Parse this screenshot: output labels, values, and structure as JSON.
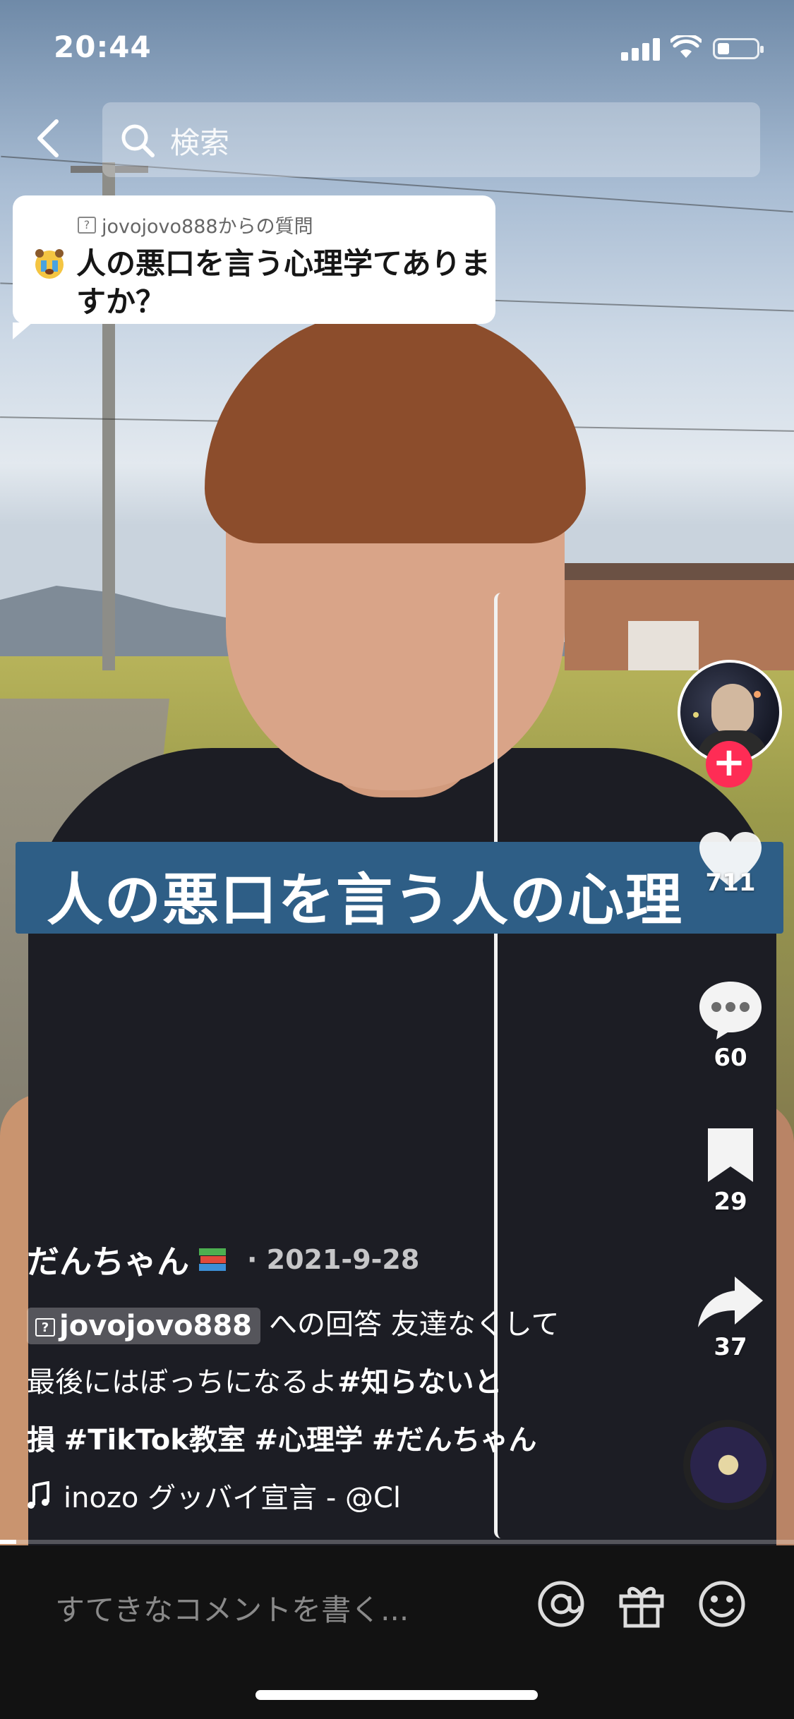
{
  "status": {
    "time": "20:44"
  },
  "search": {
    "placeholder": "検索"
  },
  "question": {
    "from": "jovojovo888からの質問",
    "text": "人の悪口を言う心理学てありますか？"
  },
  "caption": "人の悪口を言う人の心理",
  "actions": {
    "likes": "711",
    "comments": "60",
    "saves": "29",
    "shares": "37"
  },
  "post": {
    "author": "だんちゃん",
    "date": "· 2021-9-28",
    "reply_user": "jovojovo888",
    "desc_1": "への回答  友達なくして",
    "desc_2": "最後にはぼっちになるよ",
    "tag_1": "#知らないと",
    "tag_1b": "損",
    "tag_2": "#TikTok教室",
    "tag_3": "#心理学",
    "tag_4": "#だんちゃん",
    "music": "inozo   グッバイ宣言 - @Cl"
  },
  "video_progress": 0.02,
  "comment_bar": {
    "placeholder": "すてきなコメントを書く..."
  },
  "colors": {
    "follow": "#fe2c55",
    "caption_bg": "#2e5e86"
  },
  "icons": [
    "back-icon",
    "search-icon",
    "heart-icon",
    "comment-icon",
    "bookmark-icon",
    "share-icon",
    "music-note-icon",
    "mention-icon",
    "gift-icon",
    "emoji-icon"
  ]
}
